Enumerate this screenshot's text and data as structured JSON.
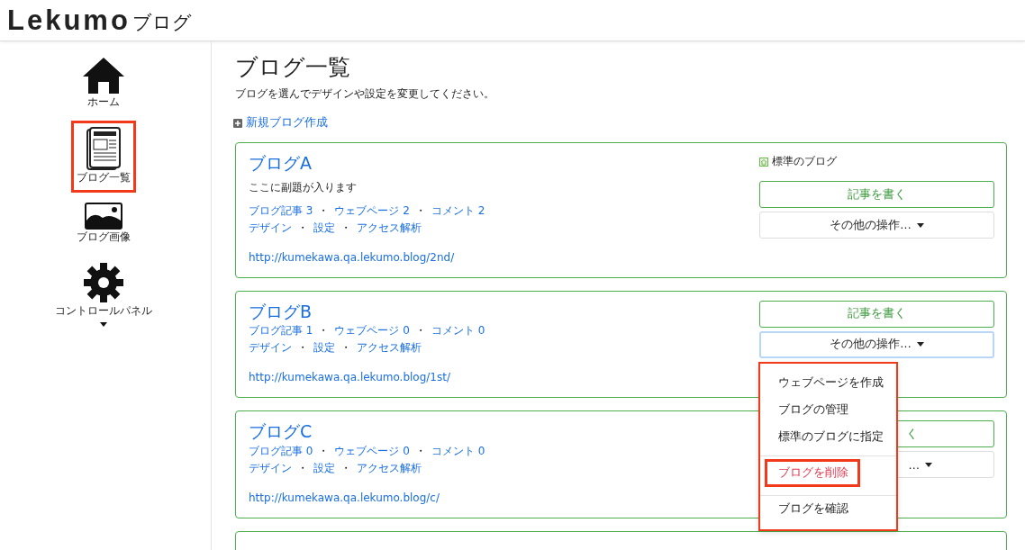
{
  "header": {
    "logo": "Lekumo",
    "logo_suffix": "ブログ"
  },
  "sidebar": {
    "items": [
      {
        "kind": "home",
        "label": "ホーム",
        "highlighted": false
      },
      {
        "kind": "list",
        "label": "ブログ一覧",
        "highlighted": true
      },
      {
        "kind": "image",
        "label": "ブログ画像",
        "highlighted": false
      },
      {
        "kind": "gear",
        "label": "コントロールパネル",
        "highlighted": false,
        "has_submenu": true
      }
    ]
  },
  "separator": "・",
  "page": {
    "title": "ブログ一覧",
    "description": "ブログを選んでデザインや設定を変更してください。",
    "new_blog": "新規ブログ作成"
  },
  "blogs": [
    {
      "name": "ブログA",
      "subtitle": "ここに副題が入ります",
      "stats": [
        "ブログ記事 3",
        "ウェブページ 2",
        "コメント 2"
      ],
      "links": [
        "デザイン",
        "設定",
        "アクセス解析"
      ],
      "url": "http://kumekawa.qa.lekumo.blog/2nd/",
      "default_label": "標準のブログ",
      "write_button": "記事を書く",
      "more_button": "その他の操作…",
      "clipped": false,
      "menu_open": false
    },
    {
      "name": "ブログB",
      "stats": [
        "ブログ記事 1",
        "ウェブページ 0",
        "コメント 0"
      ],
      "links": [
        "デザイン",
        "設定",
        "アクセス解析"
      ],
      "url": "http://kumekawa.qa.lekumo.blog/1st/",
      "write_button": "記事を書く",
      "more_button": "その他の操作…",
      "clipped": false,
      "menu_open": true
    },
    {
      "name": "ブログC",
      "stats": [
        "ブログ記事 0",
        "ウェブページ 0",
        "コメント 0"
      ],
      "links": [
        "デザイン",
        "設定",
        "アクセス解析"
      ],
      "url": "http://kumekawa.qa.lekumo.blog/c/",
      "write_button": "く",
      "more_button": "…",
      "clipped": true,
      "menu_open": false
    }
  ],
  "dropdown": {
    "highlighted": true,
    "items": [
      {
        "label": "ウェブページを作成",
        "kind": "normal",
        "highlighted": false,
        "divider_before": false
      },
      {
        "label": "ブログの管理",
        "kind": "normal",
        "highlighted": false,
        "divider_before": false
      },
      {
        "label": "標準のブログに指定",
        "kind": "normal",
        "highlighted": false,
        "divider_before": false
      },
      {
        "label": "ブログを削除",
        "kind": "danger",
        "highlighted": true,
        "divider_before": true
      },
      {
        "label": "ブログを確認",
        "kind": "normal",
        "highlighted": false,
        "divider_before": true
      }
    ]
  }
}
